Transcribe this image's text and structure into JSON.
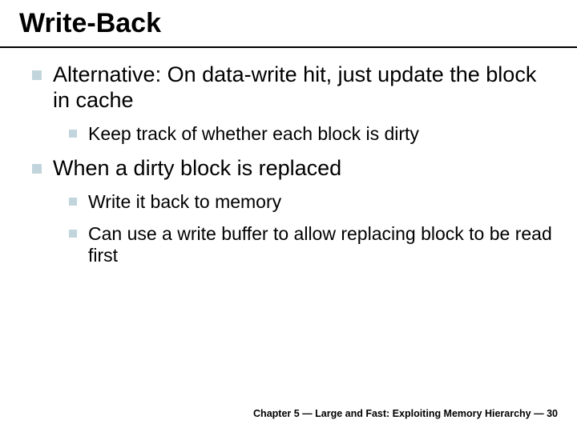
{
  "title": "Write-Back",
  "bullets": {
    "b1": "Alternative: On data-write hit, just update the block in cache",
    "b1a": "Keep track of whether each block is dirty",
    "b2": "When a dirty block is replaced",
    "b2a": "Write it back to memory",
    "b2b": "Can use a write buffer to allow replacing block to be read first"
  },
  "footer": "Chapter 5 — Large and Fast: Exploiting Memory Hierarchy — 30"
}
